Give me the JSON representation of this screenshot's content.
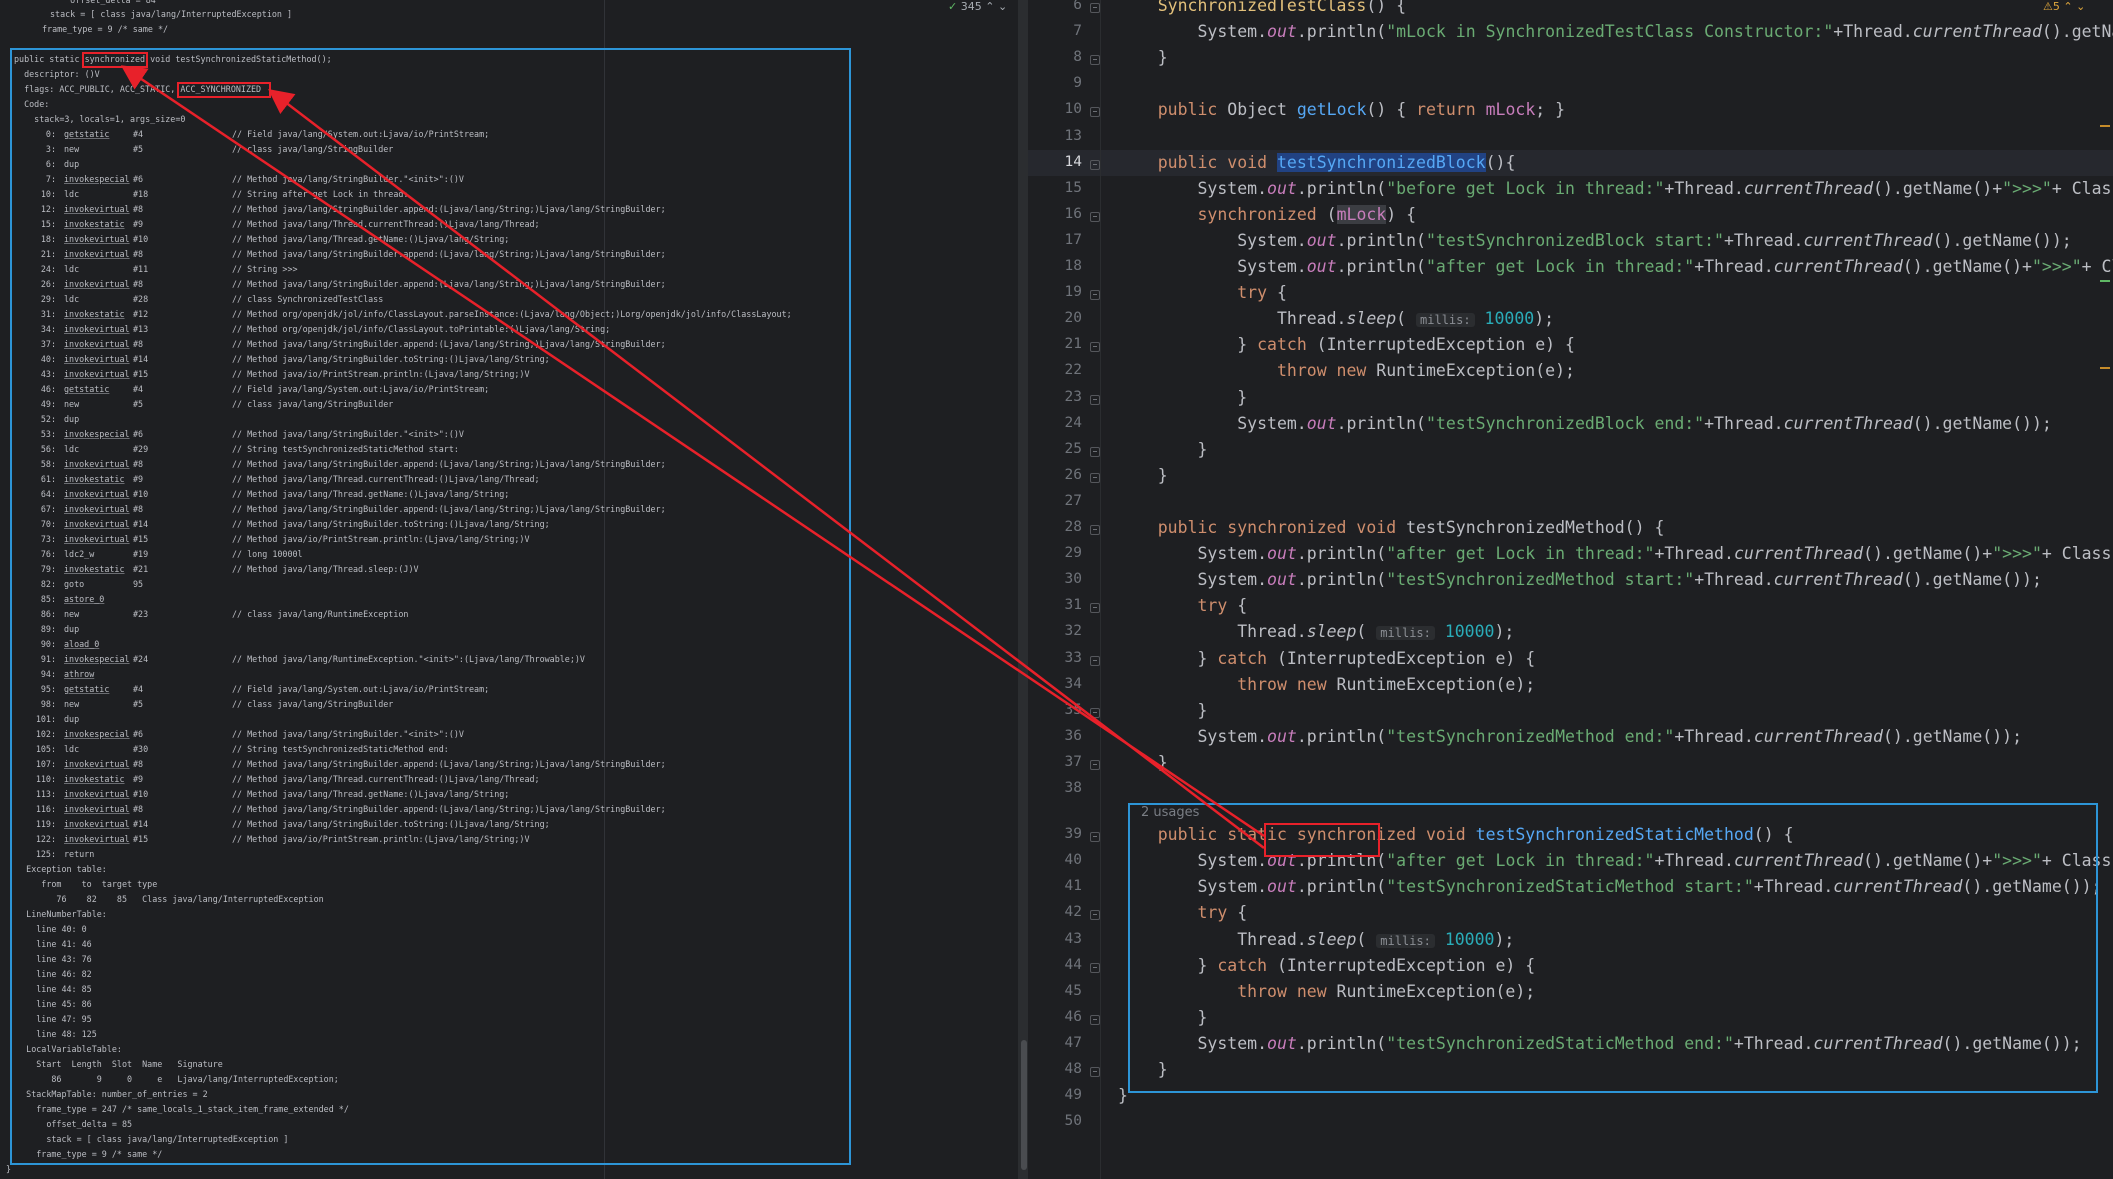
{
  "status": {
    "count": "345",
    "check": "✓",
    "warn": "⚠5"
  },
  "bytecode": {
    "top_lines": [
      "  offset_delta = 84",
      "stack = [ class java/lang/InterruptedException ]",
      "frame_type = 9 /* same */"
    ],
    "header": [
      "public static synchronized void testSynchronizedStaticMethod();",
      "  descriptor: ()V",
      "  flags: ACC_PUBLIC, ACC_STATIC, ACC_SYNCHRONIZED",
      "  Code:",
      "    stack=3, locals=1, args_size=0"
    ],
    "instructions": [
      {
        "off": "0:",
        "op": "getstatic",
        "arg": "#4",
        "cm": "// Field java/lang/System.out:Ljava/io/PrintStream;"
      },
      {
        "off": "3:",
        "op": "new",
        "arg": "#5",
        "cm": "// class java/lang/StringBuilder"
      },
      {
        "off": "6:",
        "op": "dup",
        "arg": "",
        "cm": ""
      },
      {
        "off": "7:",
        "op": "invokespecial",
        "arg": "#6",
        "cm": "// Method java/lang/StringBuilder.\"<init>\":()V"
      },
      {
        "off": "10:",
        "op": "ldc",
        "arg": "#18",
        "cm": "// String after get Lock in thread:"
      },
      {
        "off": "12:",
        "op": "invokevirtual",
        "arg": "#8",
        "cm": "// Method java/lang/StringBuilder.append:(Ljava/lang/String;)Ljava/lang/StringBuilder;"
      },
      {
        "off": "15:",
        "op": "invokestatic",
        "arg": "#9",
        "cm": "// Method java/lang/Thread.currentThread:()Ljava/lang/Thread;"
      },
      {
        "off": "18:",
        "op": "invokevirtual",
        "arg": "#10",
        "cm": "// Method java/lang/Thread.getName:()Ljava/lang/String;"
      },
      {
        "off": "21:",
        "op": "invokevirtual",
        "arg": "#8",
        "cm": "// Method java/lang/StringBuilder.append:(Ljava/lang/String;)Ljava/lang/StringBuilder;"
      },
      {
        "off": "24:",
        "op": "ldc",
        "arg": "#11",
        "cm": "// String >>>"
      },
      {
        "off": "26:",
        "op": "invokevirtual",
        "arg": "#8",
        "cm": "// Method java/lang/StringBuilder.append:(Ljava/lang/String;)Ljava/lang/StringBuilder;"
      },
      {
        "off": "29:",
        "op": "ldc",
        "arg": "#28",
        "cm": "// class SynchronizedTestClass"
      },
      {
        "off": "31:",
        "op": "invokestatic",
        "arg": "#12",
        "cm": "// Method org/openjdk/jol/info/ClassLayout.parseInstance:(Ljava/lang/Object;)Lorg/openjdk/jol/info/ClassLayout;"
      },
      {
        "off": "34:",
        "op": "invokevirtual",
        "arg": "#13",
        "cm": "// Method org/openjdk/jol/info/ClassLayout.toPrintable:()Ljava/lang/String;"
      },
      {
        "off": "37:",
        "op": "invokevirtual",
        "arg": "#8",
        "cm": "// Method java/lang/StringBuilder.append:(Ljava/lang/String;)Ljava/lang/StringBuilder;"
      },
      {
        "off": "40:",
        "op": "invokevirtual",
        "arg": "#14",
        "cm": "// Method java/lang/StringBuilder.toString:()Ljava/lang/String;"
      },
      {
        "off": "43:",
        "op": "invokevirtual",
        "arg": "#15",
        "cm": "// Method java/io/PrintStream.println:(Ljava/lang/String;)V"
      },
      {
        "off": "46:",
        "op": "getstatic",
        "arg": "#4",
        "cm": "// Field java/lang/System.out:Ljava/io/PrintStream;"
      },
      {
        "off": "49:",
        "op": "new",
        "arg": "#5",
        "cm": "// class java/lang/StringBuilder"
      },
      {
        "off": "52:",
        "op": "dup",
        "arg": "",
        "cm": ""
      },
      {
        "off": "53:",
        "op": "invokespecial",
        "arg": "#6",
        "cm": "// Method java/lang/StringBuilder.\"<init>\":()V"
      },
      {
        "off": "56:",
        "op": "ldc",
        "arg": "#29",
        "cm": "// String testSynchronizedStaticMethod start:"
      },
      {
        "off": "58:",
        "op": "invokevirtual",
        "arg": "#8",
        "cm": "// Method java/lang/StringBuilder.append:(Ljava/lang/String;)Ljava/lang/StringBuilder;"
      },
      {
        "off": "61:",
        "op": "invokestatic",
        "arg": "#9",
        "cm": "// Method java/lang/Thread.currentThread:()Ljava/lang/Thread;"
      },
      {
        "off": "64:",
        "op": "invokevirtual",
        "arg": "#10",
        "cm": "// Method java/lang/Thread.getName:()Ljava/lang/String;"
      },
      {
        "off": "67:",
        "op": "invokevirtual",
        "arg": "#8",
        "cm": "// Method java/lang/StringBuilder.append:(Ljava/lang/String;)Ljava/lang/StringBuilder;"
      },
      {
        "off": "70:",
        "op": "invokevirtual",
        "arg": "#14",
        "cm": "// Method java/lang/StringBuilder.toString:()Ljava/lang/String;"
      },
      {
        "off": "73:",
        "op": "invokevirtual",
        "arg": "#15",
        "cm": "// Method java/io/PrintStream.println:(Ljava/lang/String;)V"
      },
      {
        "off": "76:",
        "op": "ldc2_w",
        "arg": "#19",
        "cm": "// long 10000l"
      },
      {
        "off": "79:",
        "op": "invokestatic",
        "arg": "#21",
        "cm": "// Method java/lang/Thread.sleep:(J)V"
      },
      {
        "off": "82:",
        "op": "goto",
        "arg": "95",
        "cm": ""
      },
      {
        "off": "85:",
        "op": "astore_0",
        "arg": "",
        "cm": ""
      },
      {
        "off": "86:",
        "op": "new",
        "arg": "#23",
        "cm": "// class java/lang/RuntimeException"
      },
      {
        "off": "89:",
        "op": "dup",
        "arg": "",
        "cm": ""
      },
      {
        "off": "90:",
        "op": "aload_0",
        "arg": "",
        "cm": ""
      },
      {
        "off": "91:",
        "op": "invokespecial",
        "arg": "#24",
        "cm": "// Method java/lang/RuntimeException.\"<init>\":(Ljava/lang/Throwable;)V"
      },
      {
        "off": "94:",
        "op": "athrow",
        "arg": "",
        "cm": ""
      },
      {
        "off": "95:",
        "op": "getstatic",
        "arg": "#4",
        "cm": "// Field java/lang/System.out:Ljava/io/PrintStream;"
      },
      {
        "off": "98:",
        "op": "new",
        "arg": "#5",
        "cm": "// class java/lang/StringBuilder"
      },
      {
        "off": "101:",
        "op": "dup",
        "arg": "",
        "cm": ""
      },
      {
        "off": "102:",
        "op": "invokespecial",
        "arg": "#6",
        "cm": "// Method java/lang/StringBuilder.\"<init>\":()V"
      },
      {
        "off": "105:",
        "op": "ldc",
        "arg": "#30",
        "cm": "// String testSynchronizedStaticMethod end:"
      },
      {
        "off": "107:",
        "op": "invokevirtual",
        "arg": "#8",
        "cm": "// Method java/lang/StringBuilder.append:(Ljava/lang/String;)Ljava/lang/StringBuilder;"
      },
      {
        "off": "110:",
        "op": "invokestatic",
        "arg": "#9",
        "cm": "// Method java/lang/Thread.currentThread:()Ljava/lang/Thread;"
      },
      {
        "off": "113:",
        "op": "invokevirtual",
        "arg": "#10",
        "cm": "// Method java/lang/Thread.getName:()Ljava/lang/String;"
      },
      {
        "off": "116:",
        "op": "invokevirtual",
        "arg": "#8",
        "cm": "// Method java/lang/StringBuilder.append:(Ljava/lang/String;)Ljava/lang/StringBuilder;"
      },
      {
        "off": "119:",
        "op": "invokevirtual",
        "arg": "#14",
        "cm": "// Method java/lang/StringBuilder.toString:()Ljava/lang/String;"
      },
      {
        "off": "122:",
        "op": "invokevirtual",
        "arg": "#15",
        "cm": "// Method java/io/PrintStream.println:(Ljava/lang/String;)V"
      },
      {
        "off": "125:",
        "op": "return",
        "arg": "",
        "cm": ""
      }
    ],
    "footer": [
      "    Exception table:",
      "       from    to  target type",
      "          76    82    85   Class java/lang/InterruptedException",
      "    LineNumberTable:",
      "      line 40: 0",
      "      line 41: 46",
      "      line 43: 76",
      "      line 46: 82",
      "      line 44: 85",
      "      line 45: 86",
      "      line 47: 95",
      "      line 48: 125",
      "    LocalVariableTable:",
      "      Start  Length  Slot  Name   Signature",
      "         86       9     0     e   Ljava/lang/InterruptedException;",
      "    StackMapTable: number_of_entries = 2",
      "      frame_type = 247 /* same_locals_1_stack_item_frame_extended */",
      "        offset_delta = 85",
      "        stack = [ class java/lang/InterruptedException ]",
      "      frame_type = 9 /* same */",
      "}"
    ]
  },
  "editor": {
    "usages_hint": "2 usages",
    "param_hint": "millis:",
    "lines": [
      {
        "n": "6",
        "html": "    <span class=\"fnd\" style=\"color:#e2c07b\">SynchronizedTestClass</span>() {"
      },
      {
        "n": "7",
        "html": "        System.<span class=\"fld\">out</span>.println(<span class=\"st\">\"mLock in SynchronizedTestClass Constructor:\"</span>+Thread.<span class=\"it\">currentThread</span>().getName()+<span class=\"st\">\">>>\"</span>+"
      },
      {
        "n": "8",
        "html": "    }"
      },
      {
        "n": "9",
        "html": ""
      },
      {
        "n": "10",
        "html": "    <span class=\"kw\">public</span> Object <span class=\"fn\">getLock</span>() { <span class=\"kw\">return</span> <span class=\"fld2\">mLock</span>; }"
      },
      {
        "n": "13",
        "html": ""
      },
      {
        "n": "14",
        "html": "    <span class=\"kw\">public void</span> <span class=\"fn\" style=\"background:#214283\">testSynchronizedBlock</span>(){"
      },
      {
        "n": "15",
        "html": "        System.<span class=\"fld\">out</span>.println(<span class=\"st\">\"before get Lock in thread:\"</span>+Thread.<span class=\"it\">currentThread</span>().getName()+<span class=\"st\">\">>>\"</span>+ ClassLayout.<span class=\"it\">pars</span>"
      },
      {
        "n": "16",
        "html": "        <span class=\"kw\">synchronized</span> (<span class=\"fld2\" style=\"background:#3b3d42\">mLock</span>) {"
      },
      {
        "n": "17",
        "html": "            System.<span class=\"fld\">out</span>.println(<span class=\"st\">\"testSynchronizedBlock start:\"</span>+Thread.<span class=\"it\">currentThread</span>().getName());"
      },
      {
        "n": "18",
        "html": "            System.<span class=\"fld\">out</span>.println(<span class=\"st\">\"after get Lock in thread:\"</span>+Thread.<span class=\"it\">currentThread</span>().getName()+<span class=\"st\">\">>>\"</span>+ ClassLayout.<span class=\"it\">p</span>"
      },
      {
        "n": "19",
        "html": "            <span class=\"kw\">try</span> {"
      },
      {
        "n": "20",
        "html": "                Thread.<span class=\"it\">sleep</span>( <span class=\"hint\">millis:</span> <span class=\"num\">10000</span>);"
      },
      {
        "n": "21",
        "html": "            } <span class=\"kw\">catch</span> (InterruptedException e) {"
      },
      {
        "n": "22",
        "html": "                <span class=\"kw\">throw new</span> RuntimeException(e);"
      },
      {
        "n": "23",
        "html": "            }"
      },
      {
        "n": "24",
        "html": "            System.<span class=\"fld\">out</span>.println(<span class=\"st\">\"testSynchronizedBlock end:\"</span>+Thread.<span class=\"it\">currentThread</span>().getName());"
      },
      {
        "n": "25",
        "html": "        }"
      },
      {
        "n": "26",
        "html": "    }"
      },
      {
        "n": "27",
        "html": ""
      },
      {
        "n": "28",
        "html": "    <span class=\"kw\">public synchronized void</span> <span class=\"fnd\">testSynchronizedMethod</span>() {"
      },
      {
        "n": "29",
        "html": "        System.<span class=\"fld\">out</span>.println(<span class=\"st\">\"after get Lock in thread:\"</span>+Thread.<span class=\"it\">currentThread</span>().getName()+<span class=\"st\">\">>>\"</span>+ ClassLayout.<span class=\"it\">parse</span>"
      },
      {
        "n": "30",
        "html": "        System.<span class=\"fld\">out</span>.println(<span class=\"st\">\"testSynchronizedMethod start:\"</span>+Thread.<span class=\"it\">currentThread</span>().getName());"
      },
      {
        "n": "31",
        "html": "        <span class=\"kw\">try</span> {"
      },
      {
        "n": "32",
        "html": "            Thread.<span class=\"it\">sleep</span>( <span class=\"hint\">millis:</span> <span class=\"num\">10000</span>);"
      },
      {
        "n": "33",
        "html": "        } <span class=\"kw\">catch</span> (InterruptedException e) {"
      },
      {
        "n": "34",
        "html": "            <span class=\"kw\">throw new</span> RuntimeException(e);"
      },
      {
        "n": "35",
        "html": "        }"
      },
      {
        "n": "36",
        "html": "        System.<span class=\"fld\">out</span>.println(<span class=\"st\">\"testSynchronizedMethod end:\"</span>+Thread.<span class=\"it\">currentThread</span>().getName());"
      },
      {
        "n": "37",
        "html": "    }"
      },
      {
        "n": "38",
        "html": ""
      },
      {
        "n": "39",
        "html": "    <span class=\"kw\">public static synchronized void</span> <span class=\"fnd\" style=\"color:#56a8f5\">testSynchronizedStaticMethod</span>() {"
      },
      {
        "n": "40",
        "html": "        System.<span class=\"fld\">out</span>.println(<span class=\"st\">\"after get Lock in thread:\"</span>+Thread.<span class=\"it\">currentThread</span>().getName()+<span class=\"st\">\">>>\"</span>+ ClassLayout.<span class=\"it\">parse</span>"
      },
      {
        "n": "41",
        "html": "        System.<span class=\"fld\">out</span>.println(<span class=\"st\">\"testSynchronizedStaticMethod start:\"</span>+Thread.<span class=\"it\">currentThread</span>().getName());"
      },
      {
        "n": "42",
        "html": "        <span class=\"kw\">try</span> {"
      },
      {
        "n": "43",
        "html": "            Thread.<span class=\"it\">sleep</span>( <span class=\"hint\">millis:</span> <span class=\"num\">10000</span>);"
      },
      {
        "n": "44",
        "html": "        } <span class=\"kw\">catch</span> (InterruptedException e) {"
      },
      {
        "n": "45",
        "html": "            <span class=\"kw\">throw new</span> RuntimeException(e);"
      },
      {
        "n": "46",
        "html": "        }"
      },
      {
        "n": "47",
        "html": "        System.<span class=\"fld\">out</span>.println(<span class=\"st\">\"testSynchronizedStaticMethod end:\"</span>+Thread.<span class=\"it\">currentThread</span>().getName());"
      },
      {
        "n": "48",
        "html": "    }"
      },
      {
        "n": "49",
        "html": "}"
      },
      {
        "n": "50",
        "html": ""
      }
    ]
  }
}
